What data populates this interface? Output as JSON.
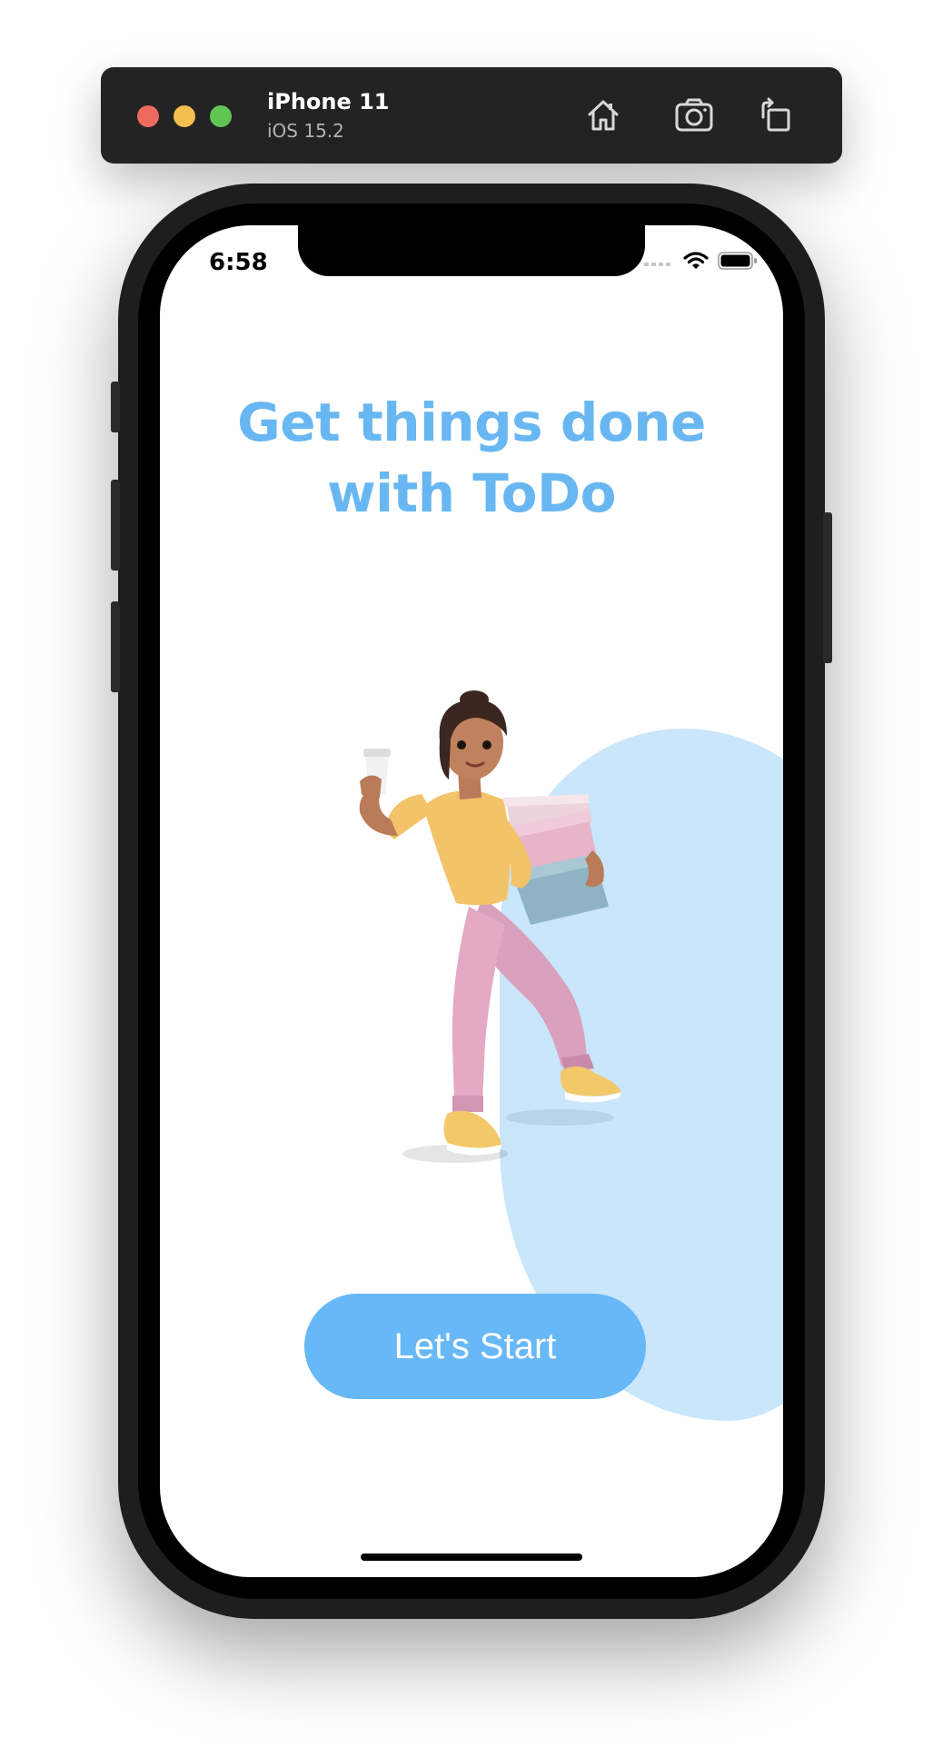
{
  "simulator": {
    "device_name": "iPhone 11",
    "os_version": "iOS 15.2",
    "toolbar_icons": [
      "home-icon",
      "screenshot-icon",
      "rotate-icon"
    ]
  },
  "status_bar": {
    "time": "6:58",
    "icons": [
      "cellular-signal-icon",
      "wifi-icon",
      "battery-icon"
    ]
  },
  "onboarding": {
    "headline_line1": "Get things done",
    "headline_line2": "with ToDo",
    "illustration": "woman-carrying-boxes-illustration",
    "start_button_label": "Let's Start"
  },
  "colors": {
    "accent": "#67b8f6",
    "headline": "#68b7f2",
    "blob": "#c9e6fb",
    "toolbar": "#232323"
  }
}
